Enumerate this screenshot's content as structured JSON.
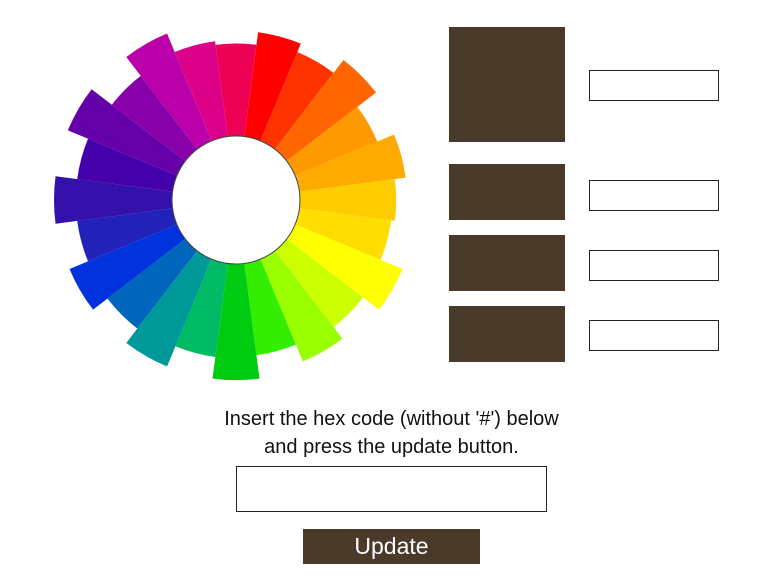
{
  "color_wheel": {
    "segments": [
      {
        "color": "#ff0000",
        "level": 0.93
      },
      {
        "color": "#ff3300",
        "level": 0.88
      },
      {
        "color": "#ff6600",
        "level": 0.97
      },
      {
        "color": "#ff9900",
        "level": 0.84
      },
      {
        "color": "#ffaa00",
        "level": 0.94
      },
      {
        "color": "#ffcc00",
        "level": 0.88
      },
      {
        "color": "#ffdd00",
        "level": 0.86
      },
      {
        "color": "#ffff00",
        "level": 0.99
      },
      {
        "color": "#ccff00",
        "level": 0.88
      },
      {
        "color": "#99ff00",
        "level": 0.96
      },
      {
        "color": "#33ee00",
        "level": 0.86
      },
      {
        "color": "#00cc11",
        "level": 0.99
      },
      {
        "color": "#00bb66",
        "level": 0.87
      },
      {
        "color": "#009999",
        "level": 0.99
      },
      {
        "color": "#0066bb",
        "level": 0.89
      },
      {
        "color": "#0033dd",
        "level": 0.99
      },
      {
        "color": "#2222bb",
        "level": 0.88
      },
      {
        "color": "#3311aa",
        "level": 1.0
      },
      {
        "color": "#4400aa",
        "level": 0.88
      },
      {
        "color": "#6600aa",
        "level": 1.0
      },
      {
        "color": "#8800aa",
        "level": 0.86
      },
      {
        "color": "#bb00aa",
        "level": 0.99
      },
      {
        "color": "#dd0088",
        "level": 0.88
      },
      {
        "color": "#ee0055",
        "level": 0.86
      }
    ],
    "center_color": "#ffffff"
  },
  "swatches": {
    "main_color": "#4a3a2a",
    "variant_colors": [
      "#4a3a2a",
      "#4a3a2a",
      "#4a3a2a"
    ]
  },
  "hex_fields": [
    {
      "value": "",
      "placeholder": ""
    },
    {
      "value": "",
      "placeholder": ""
    },
    {
      "value": "",
      "placeholder": ""
    },
    {
      "value": "",
      "placeholder": ""
    }
  ],
  "instructions": {
    "line1": "Insert the hex code (without '#') below",
    "line2": "and press the update button."
  },
  "hex_entry": {
    "value": "",
    "placeholder": ""
  },
  "update_button": {
    "label": "Update"
  }
}
